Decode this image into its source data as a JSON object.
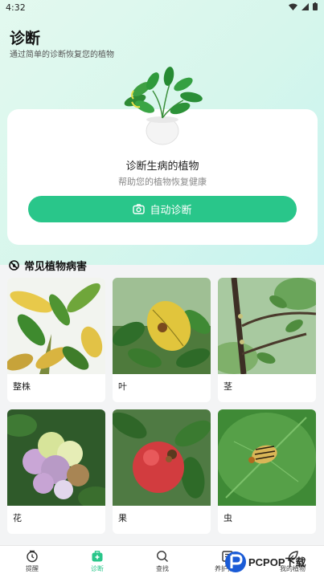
{
  "status_bar": {
    "time": "4:32"
  },
  "header": {
    "title": "诊断",
    "subtitle": "通过简单的诊断恢复您的植物"
  },
  "diagnose_card": {
    "title": "诊断生病的植物",
    "subtitle": "帮助您的植物恢复健康",
    "button_label": "自动诊断"
  },
  "section": {
    "title": "常见植物病害"
  },
  "categories": [
    {
      "label": "整株"
    },
    {
      "label": "叶"
    },
    {
      "label": "茎"
    },
    {
      "label": "花"
    },
    {
      "label": "果"
    },
    {
      "label": "虫"
    }
  ],
  "tabs": [
    {
      "label": "提醒"
    },
    {
      "label": "诊断"
    },
    {
      "label": "查找"
    },
    {
      "label": "养护指南"
    },
    {
      "label": "我的植物"
    }
  ],
  "watermark": {
    "text": "PCPOP下载"
  },
  "colors": {
    "accent": "#29c68a",
    "header_bg": "#d6f6ec"
  }
}
